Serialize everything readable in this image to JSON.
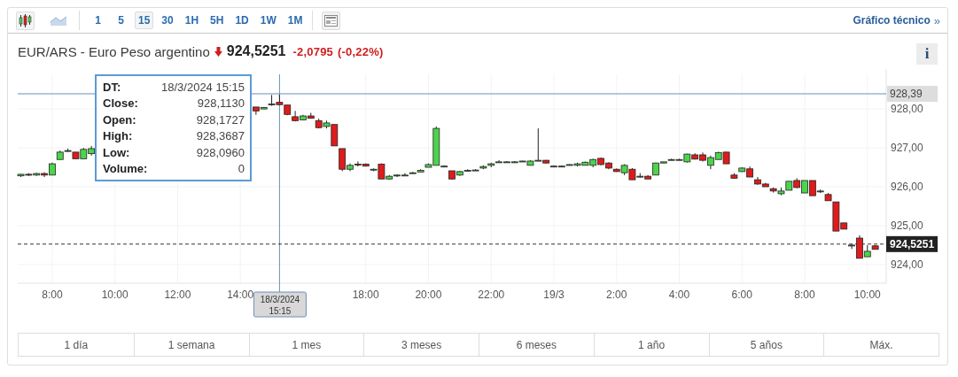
{
  "toolbar": {
    "chart_types": [
      {
        "kind": "candles",
        "selected": true
      },
      {
        "kind": "area",
        "selected": false
      }
    ],
    "intervals": [
      {
        "label": "1",
        "selected": false
      },
      {
        "label": "5",
        "selected": false
      },
      {
        "label": "15",
        "selected": true
      },
      {
        "label": "30",
        "selected": false
      },
      {
        "label": "1H",
        "selected": false
      },
      {
        "label": "5H",
        "selected": false
      },
      {
        "label": "1D",
        "selected": false
      },
      {
        "label": "1W",
        "selected": false
      },
      {
        "label": "1M",
        "selected": false
      }
    ],
    "link": {
      "label": "Gráfico técnico",
      "arrow": "»"
    }
  },
  "quote": {
    "name": "EUR/ARS - Euro Peso argentino",
    "down": true,
    "price": "924,5251",
    "change": "-2,0795",
    "change_percent": "(-0,22%)",
    "info_button": "i"
  },
  "chart": {
    "chart_data": {
      "type": "candlestick",
      "grid": true,
      "xlim": [
        "2024-03-18T06:54",
        "2024-03-19T10:36"
      ],
      "ylim": [
        923.52,
        928.89
      ],
      "x": [
        "2024-03-18T07:00",
        "2024-03-18T07:15",
        "2024-03-18T07:30",
        "2024-03-18T07:45",
        "2024-03-18T08:00",
        "2024-03-18T08:15",
        "2024-03-18T08:30",
        "2024-03-18T08:45",
        "2024-03-18T09:00",
        "2024-03-18T09:15",
        "2024-03-18T14:30",
        "2024-03-18T14:45",
        "2024-03-18T15:00",
        "2024-03-18T15:15",
        "2024-03-18T15:30",
        "2024-03-18T15:45",
        "2024-03-18T16:00",
        "2024-03-18T16:15",
        "2024-03-18T16:30",
        "2024-03-18T16:45",
        "2024-03-18T17:00",
        "2024-03-18T17:15",
        "2024-03-18T17:30",
        "2024-03-18T17:45",
        "2024-03-18T18:00",
        "2024-03-18T18:15",
        "2024-03-18T18:30",
        "2024-03-18T18:45",
        "2024-03-18T19:00",
        "2024-03-18T19:15",
        "2024-03-18T19:30",
        "2024-03-18T19:45",
        "2024-03-18T20:00",
        "2024-03-18T20:15",
        "2024-03-18T20:30",
        "2024-03-18T20:45",
        "2024-03-18T21:00",
        "2024-03-18T21:15",
        "2024-03-18T21:30",
        "2024-03-18T21:45",
        "2024-03-18T22:00",
        "2024-03-18T22:15",
        "2024-03-18T22:30",
        "2024-03-18T22:45",
        "2024-03-18T23:00",
        "2024-03-18T23:15",
        "2024-03-18T23:30",
        "2024-03-18T23:45",
        "2024-03-19T00:00",
        "2024-03-19T00:15",
        "2024-03-19T00:30",
        "2024-03-19T00:45",
        "2024-03-19T01:00",
        "2024-03-19T01:15",
        "2024-03-19T01:30",
        "2024-03-19T01:45",
        "2024-03-19T02:00",
        "2024-03-19T02:15",
        "2024-03-19T02:30",
        "2024-03-19T02:45",
        "2024-03-19T03:00",
        "2024-03-19T03:15",
        "2024-03-19T03:30",
        "2024-03-19T03:45",
        "2024-03-19T04:00",
        "2024-03-19T04:15",
        "2024-03-19T04:30",
        "2024-03-19T04:45",
        "2024-03-19T05:00",
        "2024-03-19T05:15",
        "2024-03-19T05:30",
        "2024-03-19T05:45",
        "2024-03-19T06:00",
        "2024-03-19T06:15",
        "2024-03-19T06:30",
        "2024-03-19T06:45",
        "2024-03-19T07:00",
        "2024-03-19T07:15",
        "2024-03-19T07:30",
        "2024-03-19T07:45",
        "2024-03-19T08:00",
        "2024-03-19T08:15",
        "2024-03-19T08:30",
        "2024-03-19T08:45",
        "2024-03-19T09:00",
        "2024-03-19T09:15",
        "2024-03-19T09:30",
        "2024-03-19T09:45",
        "2024-03-19T10:00",
        "2024-03-19T10:15"
      ],
      "xticks": [
        {
          "value": "2024-03-18T08:00",
          "label": "8:00"
        },
        {
          "value": "2024-03-18T10:00",
          "label": "10:00"
        },
        {
          "value": "2024-03-18T12:00",
          "label": "12:00"
        },
        {
          "value": "2024-03-18T14:00",
          "label": "14:00"
        },
        {
          "value": "2024-03-18T18:00",
          "label": "18:00"
        },
        {
          "value": "2024-03-18T20:00",
          "label": "20:00"
        },
        {
          "value": "2024-03-18T22:00",
          "label": "22:00"
        },
        {
          "value": "2024-03-19T00:00",
          "label": "19/3"
        },
        {
          "value": "2024-03-19T02:00",
          "label": "2:00"
        },
        {
          "value": "2024-03-19T04:00",
          "label": "4:00"
        },
        {
          "value": "2024-03-19T06:00",
          "label": "6:00"
        },
        {
          "value": "2024-03-19T08:00",
          "label": "8:00"
        },
        {
          "value": "2024-03-19T10:00",
          "label": "10:00"
        }
      ],
      "yticks": [
        {
          "value": 924,
          "label": "924,00"
        },
        {
          "value": 925,
          "label": "925,00"
        },
        {
          "value": 926,
          "label": "926,00"
        },
        {
          "value": 927,
          "label": "927,00"
        },
        {
          "value": 928,
          "label": "928,00"
        }
      ],
      "ohlc": [
        [
          926.28,
          926.33,
          926.25,
          926.32
        ],
        [
          926.32,
          926.35,
          926.28,
          926.3
        ],
        [
          926.3,
          926.36,
          926.28,
          926.34
        ],
        [
          926.34,
          926.37,
          926.25,
          926.3
        ],
        [
          926.3,
          926.62,
          926.3,
          926.59
        ],
        [
          926.7,
          926.93,
          926.7,
          926.89
        ],
        [
          926.93,
          926.98,
          926.9,
          926.93
        ],
        [
          926.89,
          926.89,
          926.72,
          926.72
        ],
        [
          926.72,
          927.0,
          926.72,
          926.96
        ],
        [
          926.85,
          927.05,
          926.8,
          926.98
        ],
        [
          928.05,
          928.05,
          927.85,
          927.95
        ],
        [
          928.0,
          928.05,
          928.0,
          928.04
        ],
        [
          928.11,
          928.36,
          928.08,
          928.13
        ],
        [
          928.17,
          928.37,
          928.1,
          928.11
        ],
        [
          928.1,
          928.1,
          927.84,
          927.86
        ],
        [
          927.8,
          927.95,
          927.68,
          927.7
        ],
        [
          927.72,
          927.85,
          927.72,
          927.82
        ],
        [
          927.82,
          927.9,
          927.75,
          927.76
        ],
        [
          927.7,
          927.75,
          927.5,
          927.52
        ],
        [
          927.55,
          927.7,
          927.5,
          927.64
        ],
        [
          927.6,
          927.6,
          927.05,
          927.05
        ],
        [
          926.98,
          926.98,
          926.4,
          926.45
        ],
        [
          926.45,
          926.6,
          926.4,
          926.55
        ],
        [
          926.58,
          926.65,
          926.52,
          926.56
        ],
        [
          926.58,
          926.6,
          926.52,
          926.53
        ],
        [
          926.45,
          926.47,
          926.4,
          926.45
        ],
        [
          926.58,
          926.6,
          926.2,
          926.2
        ],
        [
          926.2,
          926.3,
          926.18,
          926.27
        ],
        [
          926.3,
          926.32,
          926.25,
          926.3
        ],
        [
          926.3,
          926.35,
          926.28,
          926.3
        ],
        [
          926.36,
          926.38,
          926.34,
          926.36
        ],
        [
          926.38,
          926.45,
          926.38,
          926.42
        ],
        [
          926.5,
          926.6,
          926.5,
          926.57
        ],
        [
          926.55,
          927.55,
          926.55,
          927.5
        ],
        [
          926.53,
          926.55,
          926.5,
          926.53
        ],
        [
          926.41,
          926.41,
          926.18,
          926.2
        ],
        [
          926.3,
          926.41,
          926.28,
          926.39
        ],
        [
          926.42,
          926.45,
          926.4,
          926.42
        ],
        [
          926.43,
          926.45,
          926.41,
          926.43
        ],
        [
          926.48,
          926.55,
          926.45,
          926.52
        ],
        [
          926.55,
          926.62,
          926.5,
          926.59
        ],
        [
          926.64,
          926.68,
          926.62,
          926.64
        ],
        [
          926.64,
          926.66,
          926.63,
          926.64
        ],
        [
          926.64,
          926.66,
          926.63,
          926.64
        ],
        [
          926.66,
          926.67,
          926.65,
          926.66
        ],
        [
          926.55,
          926.68,
          926.55,
          926.66
        ],
        [
          926.68,
          927.5,
          926.66,
          926.68
        ],
        [
          926.68,
          926.69,
          926.6,
          926.61
        ],
        [
          926.53,
          926.55,
          926.5,
          926.53
        ],
        [
          926.53,
          926.55,
          926.51,
          926.53
        ],
        [
          926.55,
          926.58,
          926.55,
          926.57
        ],
        [
          926.55,
          926.62,
          926.52,
          926.59
        ],
        [
          926.55,
          926.65,
          926.55,
          926.63
        ],
        [
          926.55,
          926.72,
          926.5,
          926.7
        ],
        [
          926.73,
          926.75,
          926.55,
          926.57
        ],
        [
          926.61,
          926.63,
          926.45,
          926.48
        ],
        [
          926.45,
          926.47,
          926.38,
          926.39
        ],
        [
          926.36,
          926.58,
          926.3,
          926.55
        ],
        [
          926.45,
          926.48,
          926.18,
          926.18
        ],
        [
          926.25,
          926.35,
          926.23,
          926.27
        ],
        [
          926.27,
          926.3,
          926.2,
          926.2
        ],
        [
          926.3,
          926.62,
          926.3,
          926.61
        ],
        [
          926.61,
          926.64,
          926.61,
          926.64
        ],
        [
          926.7,
          926.72,
          926.68,
          926.7
        ],
        [
          926.7,
          926.72,
          926.68,
          926.7
        ],
        [
          926.64,
          926.85,
          926.62,
          926.84
        ],
        [
          926.82,
          926.86,
          926.7,
          926.71
        ],
        [
          926.82,
          926.88,
          926.65,
          926.68
        ],
        [
          926.55,
          926.8,
          926.45,
          926.75
        ],
        [
          926.7,
          926.9,
          926.7,
          926.88
        ],
        [
          926.89,
          926.9,
          926.59,
          926.59
        ],
        [
          926.3,
          926.35,
          926.2,
          926.22
        ],
        [
          926.39,
          926.5,
          926.38,
          926.48
        ],
        [
          926.46,
          926.52,
          926.25,
          926.25
        ],
        [
          926.18,
          926.25,
          926.05,
          926.07
        ],
        [
          926.07,
          926.1,
          926.0,
          926.0
        ],
        [
          925.95,
          925.98,
          925.85,
          925.89
        ],
        [
          925.82,
          925.98,
          925.78,
          925.89
        ],
        [
          925.91,
          926.14,
          925.91,
          926.14
        ],
        [
          926.16,
          926.22,
          925.96,
          925.98
        ],
        [
          925.84,
          926.16,
          925.84,
          926.16
        ],
        [
          926.16,
          926.16,
          925.77,
          925.77
        ],
        [
          925.89,
          925.93,
          925.84,
          925.89
        ],
        [
          925.8,
          925.84,
          925.64,
          925.64
        ],
        [
          925.61,
          925.61,
          924.86,
          924.86
        ],
        [
          925.07,
          925.07,
          924.91,
          924.91
        ],
        [
          924.5,
          924.52,
          924.4,
          924.5
        ],
        [
          924.68,
          924.75,
          924.16,
          924.16
        ],
        [
          924.2,
          924.5,
          924.2,
          924.34
        ],
        [
          924.48,
          924.5,
          924.39,
          924.39
        ]
      ],
      "ref_lines": [
        {
          "axis": "y",
          "value": 928.39,
          "label": "928,39"
        },
        {
          "axis": "x",
          "value": "2024-03-18T15:15",
          "label": "18/3/2024 15:15"
        },
        {
          "axis": "y",
          "value": 924.5251,
          "label": "924,5251"
        }
      ]
    },
    "tooltip": [
      {
        "label": "DT:",
        "value": "18/3/2024 15:15"
      },
      {
        "label": "Close:",
        "value": "928,1130"
      },
      {
        "label": "Open:",
        "value": "928,1727"
      },
      {
        "label": "High:",
        "value": "928,3687"
      },
      {
        "label": "Low:",
        "value": "928,0960"
      },
      {
        "label": "Volume:",
        "value": "0"
      }
    ]
  },
  "ranges": [
    "1 día",
    "1 semana",
    "1 mes",
    "3 meses",
    "6 meses",
    "1 año",
    "5 años",
    "Máx."
  ]
}
